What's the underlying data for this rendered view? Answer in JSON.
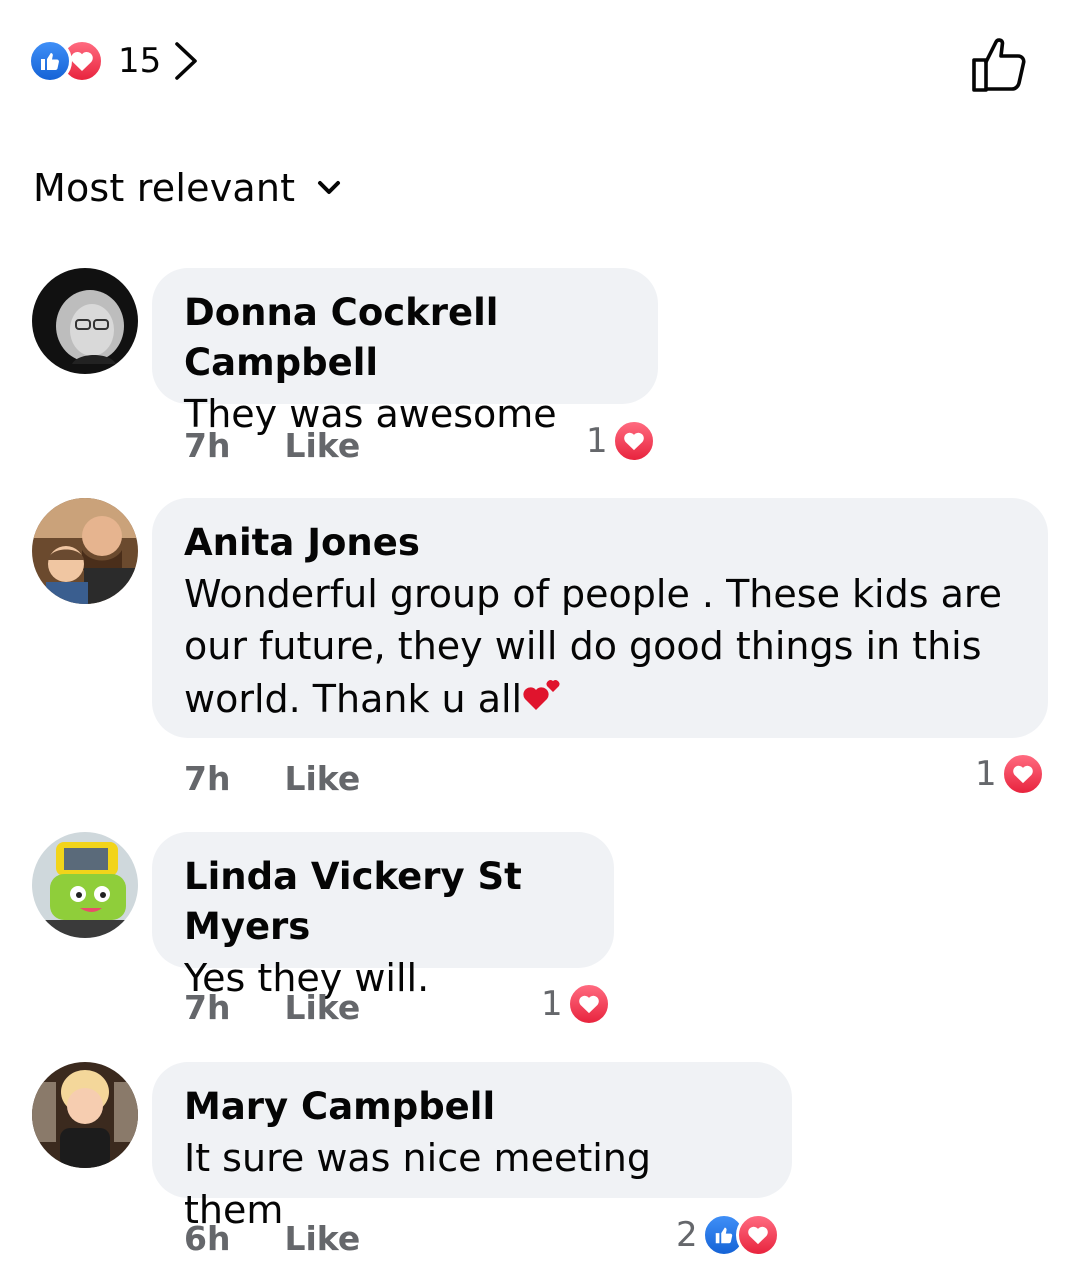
{
  "header": {
    "reaction_count": "15",
    "reaction_icons": [
      "like-icon",
      "love-icon"
    ],
    "like_button_icon": "thumbs-up-outline-icon"
  },
  "sort": {
    "label": "Most relevant",
    "icon": "chevron-down-icon"
  },
  "colors": {
    "like_blue": "#1877f2",
    "love_red": "#f02849",
    "bubble_bg": "#f0f2f5",
    "meta_gray": "#65676b"
  },
  "comments": [
    {
      "name": "Donna Cockrell Campbell",
      "lines": [
        "They was awesome"
      ],
      "time": "7h",
      "like_label": "Like",
      "reaction_count": "1",
      "reactions": [
        "love"
      ]
    },
    {
      "name": "Anita Jones",
      "lines": [
        "Wonderful group of people . These kids are",
        "our future, they will do good things in this",
        "world. Thank u all"
      ],
      "emoji": "two-hearts-emoji",
      "time": "7h",
      "like_label": "Like",
      "reaction_count": "1",
      "reactions": [
        "love"
      ]
    },
    {
      "name": "Linda Vickery St Myers",
      "lines": [
        "Yes they will."
      ],
      "time": "7h",
      "like_label": "Like",
      "reaction_count": "1",
      "reactions": [
        "love"
      ]
    },
    {
      "name": "Mary Campbell",
      "lines": [
        "It sure was nice meeting them"
      ],
      "time": "6h",
      "like_label": "Like",
      "reaction_count": "2",
      "reactions": [
        "like",
        "love"
      ]
    }
  ]
}
